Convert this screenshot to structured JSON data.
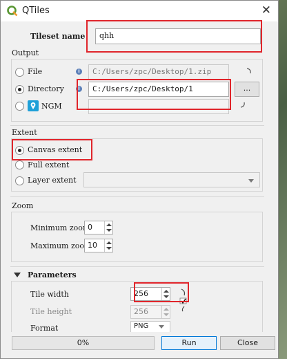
{
  "window": {
    "title": "QTiles",
    "close_glyph": "✕"
  },
  "tileset_name": {
    "label": "Tileset name",
    "value": "qhh"
  },
  "output": {
    "title": "Output",
    "file": {
      "label": "File",
      "path": "C:/Users/zpc/Desktop/1.zip"
    },
    "directory": {
      "label": "Directory",
      "path": "C:/Users/zpc/Desktop/1",
      "browse_label": "..."
    },
    "ngm": {
      "label": "NGM",
      "path": ""
    }
  },
  "extent": {
    "title": "Extent",
    "canvas": "Canvas extent",
    "full": "Full extent",
    "layer": "Layer extent",
    "selected": "canvas"
  },
  "zoom": {
    "title": "Zoom",
    "min_label": "Minimum zoom",
    "min_value": "0",
    "max_label": "Maximum zoom",
    "max_value": "10"
  },
  "parameters": {
    "title": "Parameters",
    "tile_width_label": "Tile width",
    "tile_width": "256",
    "tile_height_label": "Tile height",
    "tile_height": "256",
    "format_label": "Format",
    "format_value": "PNG"
  },
  "footer": {
    "progress": "0%",
    "run": "Run",
    "close": "Close"
  },
  "colors": {
    "highlight": "#e0252b",
    "qgis_green": "#589632",
    "ngm_blue": "#1fa0d8"
  },
  "icons": [
    "qgis-logo-icon",
    "info-icon",
    "ngm-icon",
    "spinner-icon",
    "chain-link-icon",
    "collapse-arrow-icon"
  ]
}
